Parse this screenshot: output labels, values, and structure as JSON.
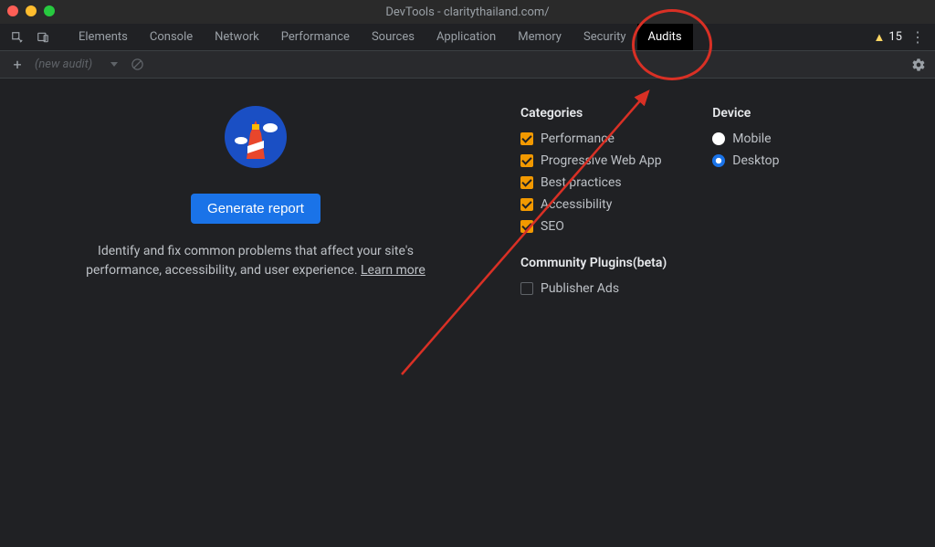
{
  "window": {
    "title": "DevTools - claritythailand.com/"
  },
  "tabs": [
    "Elements",
    "Console",
    "Network",
    "Performance",
    "Sources",
    "Application",
    "Memory",
    "Security",
    "Audits"
  ],
  "active_tab_index": 8,
  "warnings_count": "15",
  "subbar": {
    "new_audit_placeholder": "(new audit)"
  },
  "generate": {
    "button_label": "Generate report",
    "desc_line1": "Identify and fix common problems that affect your site's",
    "desc_line2_prefix": "performance, accessibility, and user experience. ",
    "learn_more": "Learn more"
  },
  "categories": {
    "heading": "Categories",
    "items": [
      {
        "label": "Performance",
        "checked": true
      },
      {
        "label": "Progressive Web App",
        "checked": true
      },
      {
        "label": "Best practices",
        "checked": true
      },
      {
        "label": "Accessibility",
        "checked": true
      },
      {
        "label": "SEO",
        "checked": true
      }
    ]
  },
  "plugins": {
    "heading": "Community Plugins(beta)",
    "items": [
      {
        "label": "Publisher Ads",
        "checked": false
      }
    ]
  },
  "device": {
    "heading": "Device",
    "options": [
      {
        "label": "Mobile",
        "selected": false
      },
      {
        "label": "Desktop",
        "selected": true
      }
    ]
  }
}
